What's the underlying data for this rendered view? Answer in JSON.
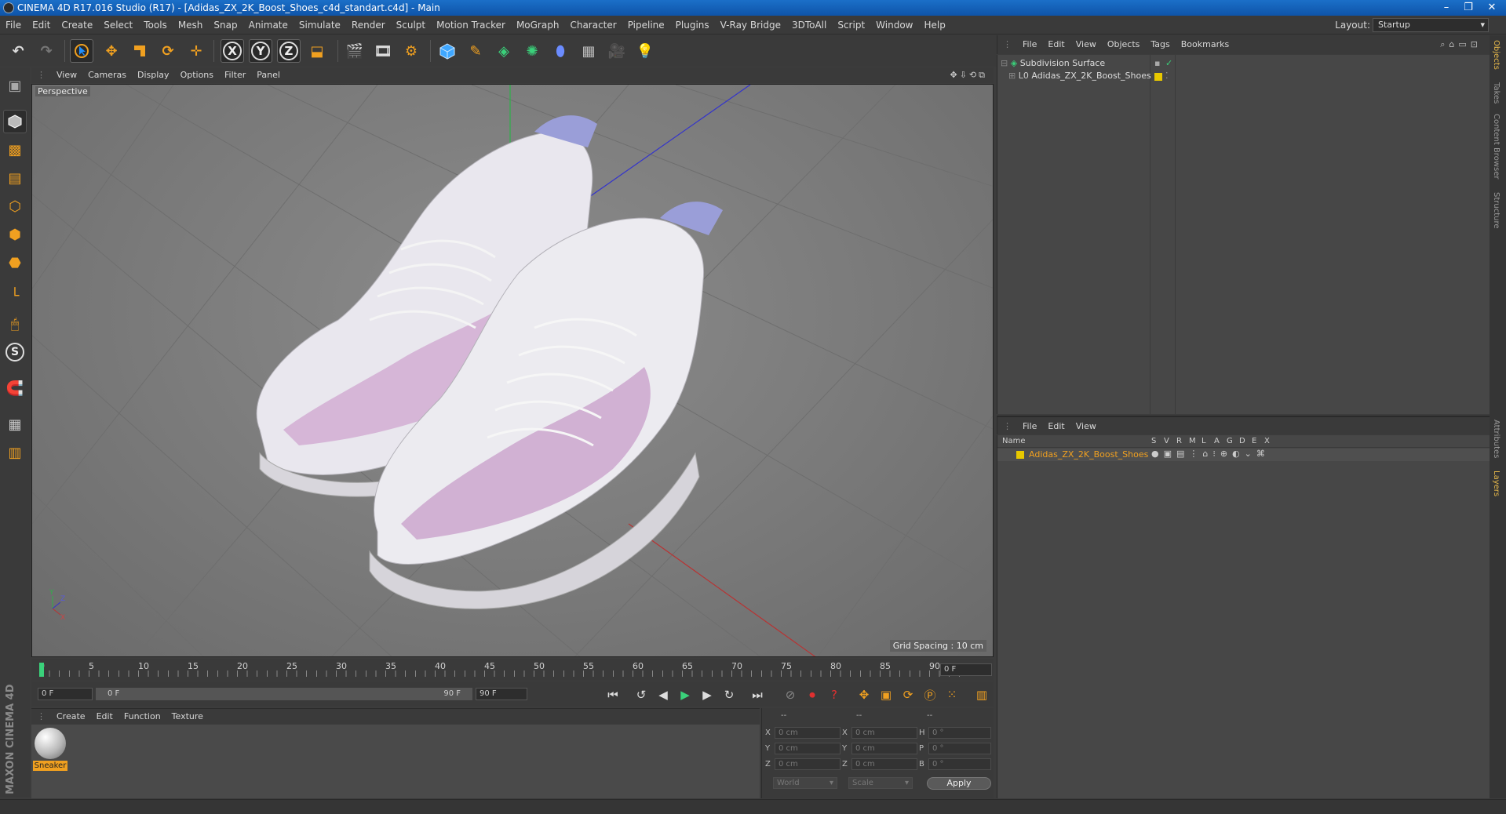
{
  "window": {
    "title": "CINEMA 4D R17.016 Studio (R17) - [Adidas_ZX_2K_Boost_Shoes_c4d_standart.c4d] - Main",
    "controls": [
      "–",
      "❐",
      "✕"
    ]
  },
  "menubar": {
    "items": [
      "File",
      "Edit",
      "Create",
      "Select",
      "Tools",
      "Mesh",
      "Snap",
      "Animate",
      "Simulate",
      "Render",
      "Sculpt",
      "Motion Tracker",
      "MoGraph",
      "Character",
      "Pipeline",
      "Plugins",
      "V-Ray Bridge",
      "3DToAll",
      "Script",
      "Window",
      "Help"
    ],
    "layout_label": "Layout:",
    "layout_value": "Startup"
  },
  "toolbar": {
    "axis_x": "X",
    "axis_y": "Y",
    "axis_z": "Z"
  },
  "viewport": {
    "menu": [
      "View",
      "Cameras",
      "Display",
      "Options",
      "Filter",
      "Panel"
    ],
    "label": "Perspective",
    "grid_spacing": "Grid Spacing : 10 cm",
    "axis_labels": {
      "y": "Y",
      "z": "Z",
      "x": "X"
    }
  },
  "timeline": {
    "ticks": [
      "0",
      "5",
      "10",
      "15",
      "20",
      "25",
      "30",
      "35",
      "40",
      "45",
      "50",
      "55",
      "60",
      "65",
      "70",
      "75",
      "80",
      "85",
      "90"
    ],
    "current_frame": "0 F"
  },
  "playbar": {
    "start_field": "0 F",
    "range_start": "0 F",
    "range_end": "90 F",
    "end_field": "90 F"
  },
  "materials": {
    "menu": [
      "Create",
      "Edit",
      "Function",
      "Texture"
    ],
    "items": [
      {
        "name": "Sneaker"
      }
    ]
  },
  "coords": {
    "headers": [
      "--",
      "--",
      "--"
    ],
    "rows": [
      {
        "l1": "X",
        "v1": "0 cm",
        "l2": "X",
        "v2": "0 cm",
        "l3": "H",
        "v3": "0 °"
      },
      {
        "l1": "Y",
        "v1": "0 cm",
        "l2": "Y",
        "v2": "0 cm",
        "l3": "P",
        "v3": "0 °"
      },
      {
        "l1": "Z",
        "v1": "0 cm",
        "l2": "Z",
        "v2": "0 cm",
        "l3": "B",
        "v3": "0 °"
      }
    ],
    "mode": "World",
    "transform": "Scale",
    "apply": "Apply"
  },
  "objects": {
    "menu": [
      "File",
      "Edit",
      "View",
      "Objects",
      "Tags",
      "Bookmarks"
    ],
    "tree": [
      {
        "name": "Subdivision Surface"
      },
      {
        "name": "Adidas_ZX_2K_Boost_Shoes"
      }
    ]
  },
  "layers": {
    "menu": [
      "File",
      "Edit",
      "View"
    ],
    "columns": [
      "Name",
      "S",
      "V",
      "R",
      "M",
      "L",
      "A",
      "G",
      "D",
      "E",
      "X"
    ],
    "rows": [
      {
        "name": "Adidas_ZX_2K_Boost_Shoes",
        "color": "#e8c800"
      }
    ]
  },
  "right_tabs": [
    "Objects",
    "Takes",
    "Content Browser",
    "Structure",
    "Attributes",
    "Layers"
  ],
  "colors": {
    "accent_orange": "#f0a020",
    "layer_yellow": "#e8c800",
    "titlebar_blue": "#1b6fc8"
  }
}
